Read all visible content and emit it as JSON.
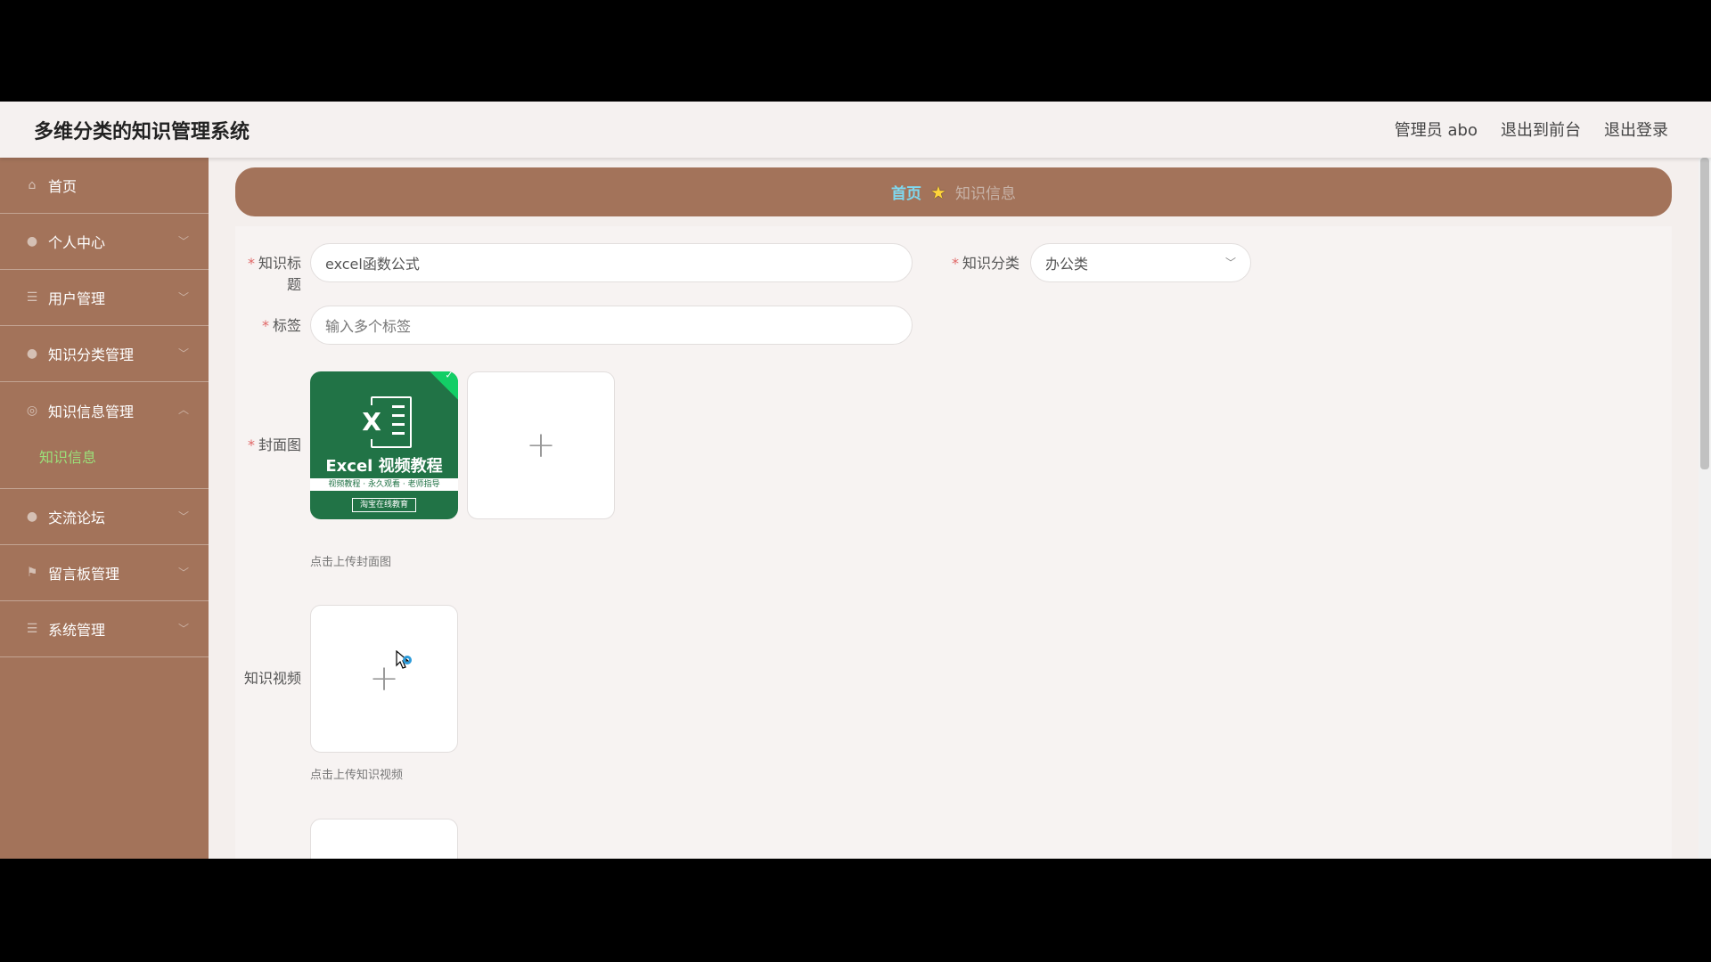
{
  "app": {
    "title": "多维分类的知识管理系统",
    "user": "管理员 abo",
    "to_front": "退出到前台",
    "logout": "退出登录"
  },
  "sidebar": {
    "items": [
      {
        "label": "首页",
        "icon": "home-icon"
      },
      {
        "label": "个人中心",
        "icon": "user-icon"
      },
      {
        "label": "用户管理",
        "icon": "list-icon"
      },
      {
        "label": "知识分类管理",
        "icon": "user-icon"
      },
      {
        "label": "知识信息管理",
        "icon": "circle-icon",
        "sub": "知识信息"
      },
      {
        "label": "交流论坛",
        "icon": "user-icon"
      },
      {
        "label": "留言板管理",
        "icon": "flag-icon"
      },
      {
        "label": "系统管理",
        "icon": "list-icon"
      }
    ]
  },
  "breadcrumb": {
    "home": "首页",
    "current": "知识信息"
  },
  "form": {
    "title_label": "知识标题",
    "title_value": "excel函数公式",
    "category_label": "知识分类",
    "category_value": "办公类",
    "tags_label": "标签",
    "tags_placeholder": "输入多个标签",
    "cover_label": "封面图",
    "cover_hint": "点击上传封面图",
    "video_label": "知识视频",
    "video_hint": "点击上传知识视频"
  },
  "thumbnail": {
    "main": "Excel 视频教程",
    "sub": "视频教程 · 永久观看 · 老师指导",
    "footer": "淘宝在线教育"
  },
  "colors": {
    "sidebar": "#a3735a",
    "breadcrumb_home": "#7fd8ef",
    "sub_active": "#9be07a"
  }
}
